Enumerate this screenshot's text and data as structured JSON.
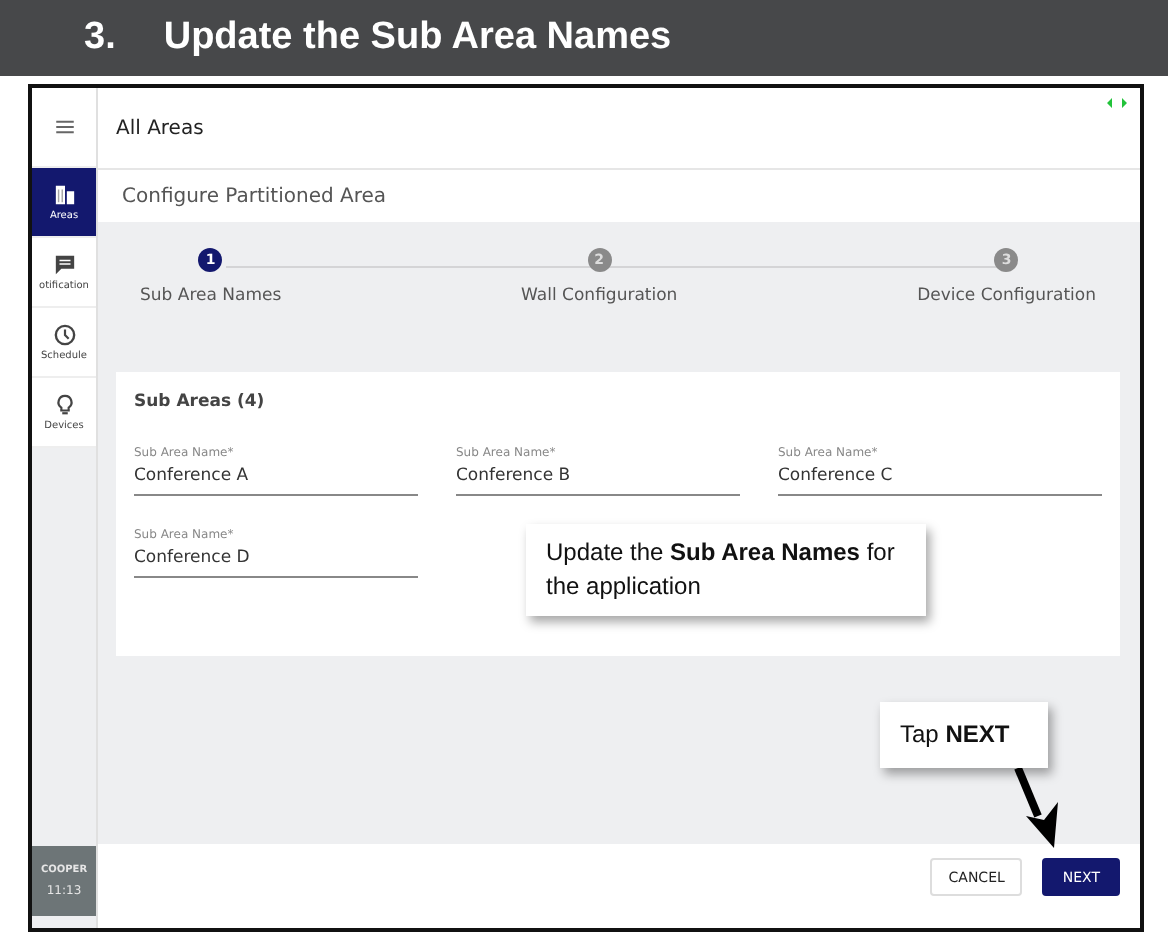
{
  "banner": {
    "number": "3.",
    "title": "Update the Sub Area Names"
  },
  "sidebar": {
    "items": [
      {
        "label": "Areas",
        "kind": "areas",
        "selected": true
      },
      {
        "label": "otification",
        "kind": "chat",
        "selected": false
      },
      {
        "label": "Schedule",
        "kind": "clock",
        "selected": false
      },
      {
        "label": "Devices",
        "kind": "bulb",
        "selected": false
      }
    ],
    "logo": "COOPER",
    "time": "11:13"
  },
  "topbar": {
    "title": "All Areas"
  },
  "subheader": "Configure Partitioned Area",
  "steps": [
    {
      "number": "1",
      "label": "Sub Area Names",
      "selected": true
    },
    {
      "number": "2",
      "label": "Wall Configuration",
      "selected": false
    },
    {
      "number": "3",
      "label": "Device Configuration",
      "selected": false
    }
  ],
  "card": {
    "title": "Sub Areas (4)",
    "fields": [
      {
        "label": "Sub Area Name*",
        "value": "Conference A"
      },
      {
        "label": "Sub Area Name*",
        "value": "Conference B"
      },
      {
        "label": "Sub Area Name*",
        "value": "Conference C"
      },
      {
        "label": "Sub Area Name*",
        "value": "Conference D"
      }
    ]
  },
  "buttons": [
    {
      "label": "CANCEL",
      "kind": "secondary"
    },
    {
      "label": "NEXT",
      "kind": "primary"
    }
  ],
  "callouts": [
    {
      "text": "Update the **Sub Area Names** for the application",
      "arrow": false
    },
    {
      "text": "Tap **NEXT**",
      "arrow": true
    }
  ]
}
